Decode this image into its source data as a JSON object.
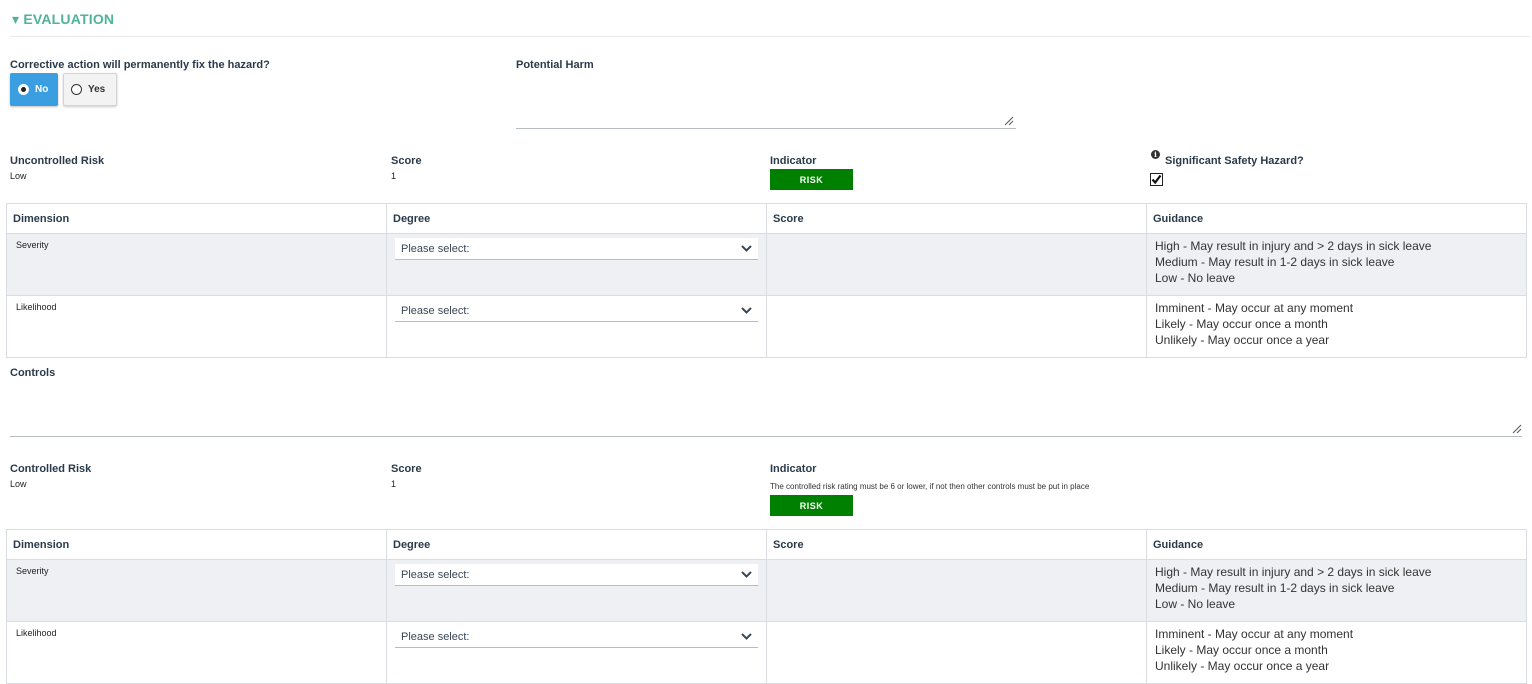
{
  "section": {
    "title": "▾ EVALUATION"
  },
  "corrective": {
    "label": "Corrective action will permanently fix the hazard?",
    "options": [
      "No",
      "Yes"
    ],
    "selected": "No"
  },
  "potential_harm": {
    "label": "Potential Harm",
    "value": ""
  },
  "uncontrolled": {
    "risk_label": "Uncontrolled Risk",
    "risk_value": "Low",
    "score_label": "Score",
    "score_value": "1",
    "indicator_label": "Indicator",
    "indicator_badge": "RISK",
    "indicator_color": "#008000",
    "significant_label": "Significant Safety Hazard?",
    "significant_checked": true,
    "table": {
      "headers": [
        "Dimension",
        "Degree",
        "Score",
        "Guidance"
      ],
      "rows": [
        {
          "dimension": "Severity",
          "degree": "Please select:",
          "score": "",
          "guidance": [
            "High - May result in injury and > 2 days in sick leave",
            "Medium - May result in 1-2 days in sick leave",
            "Low - No leave"
          ]
        },
        {
          "dimension": "Likelihood",
          "degree": "Please select:",
          "score": "",
          "guidance": [
            "Imminent - May occur at any moment",
            "Likely - May occur once a month",
            "Unlikely - May occur once a year"
          ]
        }
      ]
    }
  },
  "controls": {
    "label": "Controls",
    "value": ""
  },
  "controlled": {
    "risk_label": "Controlled Risk",
    "risk_value": "Low",
    "score_label": "Score",
    "score_value": "1",
    "indicator_label": "Indicator",
    "indicator_note": "The controlled risk rating must be 6 or lower, if not then other controls must be put in place",
    "indicator_badge": "RISK",
    "table": {
      "headers": [
        "Dimension",
        "Degree",
        "Score",
        "Guidance"
      ],
      "rows": [
        {
          "dimension": "Severity",
          "degree": "Please select:",
          "score": "",
          "guidance": [
            "High - May result in injury and > 2 days in sick leave",
            "Medium - May result in 1-2 days in sick leave",
            "Low - No leave"
          ]
        },
        {
          "dimension": "Likelihood",
          "degree": "Please select:",
          "score": "",
          "guidance": [
            "Imminent - May occur at any moment",
            "Likely - May occur once a month",
            "Unlikely - May occur once a year"
          ]
        }
      ]
    }
  },
  "colors": {
    "accent": "#4fb39a",
    "primary": "#3a9ee0",
    "risk": "#008000",
    "row_grey": "#eff0f4"
  }
}
